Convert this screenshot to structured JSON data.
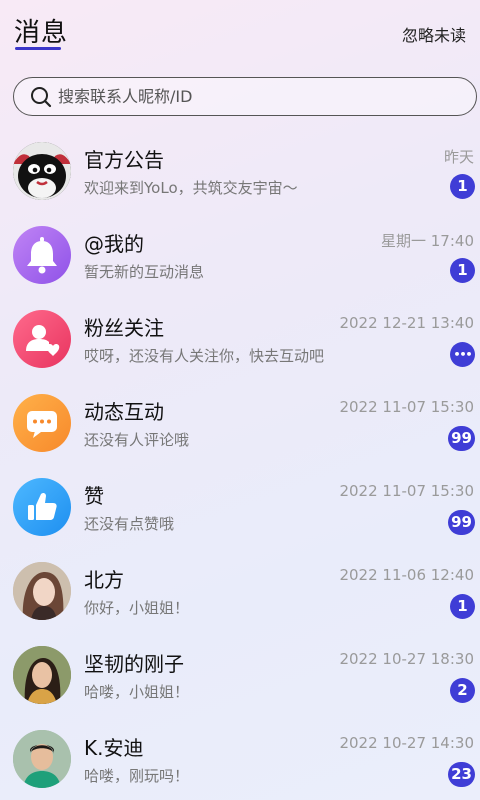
{
  "header": {
    "title": "消息",
    "ignore_unread": "忽略未读"
  },
  "search": {
    "placeholder": "搜索联系人昵称/ID"
  },
  "colors": {
    "accent": "#3f3dd6",
    "title_underline": "#3b36c9"
  },
  "conversations": [
    {
      "name": "官方公告",
      "preview": "欢迎来到YoLo，共筑交友宇宙～",
      "time": "昨天",
      "badge": "1",
      "avatar": "official-mascot-icon"
    },
    {
      "name": "@我的",
      "preview": "暂无新的互动消息",
      "time": "星期一 17:40",
      "badge": "1",
      "avatar": "bell-icon"
    },
    {
      "name": "粉丝关注",
      "preview": "哎呀，还没有人关注你，快去互动吧",
      "time": "2022 12-21 13:40",
      "badge": "•••",
      "avatar": "follower-heart-icon"
    },
    {
      "name": "动态互动",
      "preview": "还没有人评论哦",
      "time": "2022 11-07 15:30",
      "badge": "99",
      "avatar": "comment-bubble-icon"
    },
    {
      "name": "赞",
      "preview": "还没有点赞哦",
      "time": "2022 11-07 15:30",
      "badge": "99",
      "avatar": "thumbs-up-icon"
    },
    {
      "name": "北方",
      "preview": "你好，小姐姐！",
      "time": "2022 11-06 12:40",
      "badge": "1",
      "avatar": "user-photo"
    },
    {
      "name": "坚韧的刚子",
      "preview": "哈喽，小姐姐！",
      "time": "2022 10-27 18:30",
      "badge": "2",
      "avatar": "user-photo"
    },
    {
      "name": "K.安迪",
      "preview": "哈喽，刚玩吗！",
      "time": "2022 10-27 14:30",
      "badge": "23",
      "avatar": "user-photo"
    }
  ]
}
